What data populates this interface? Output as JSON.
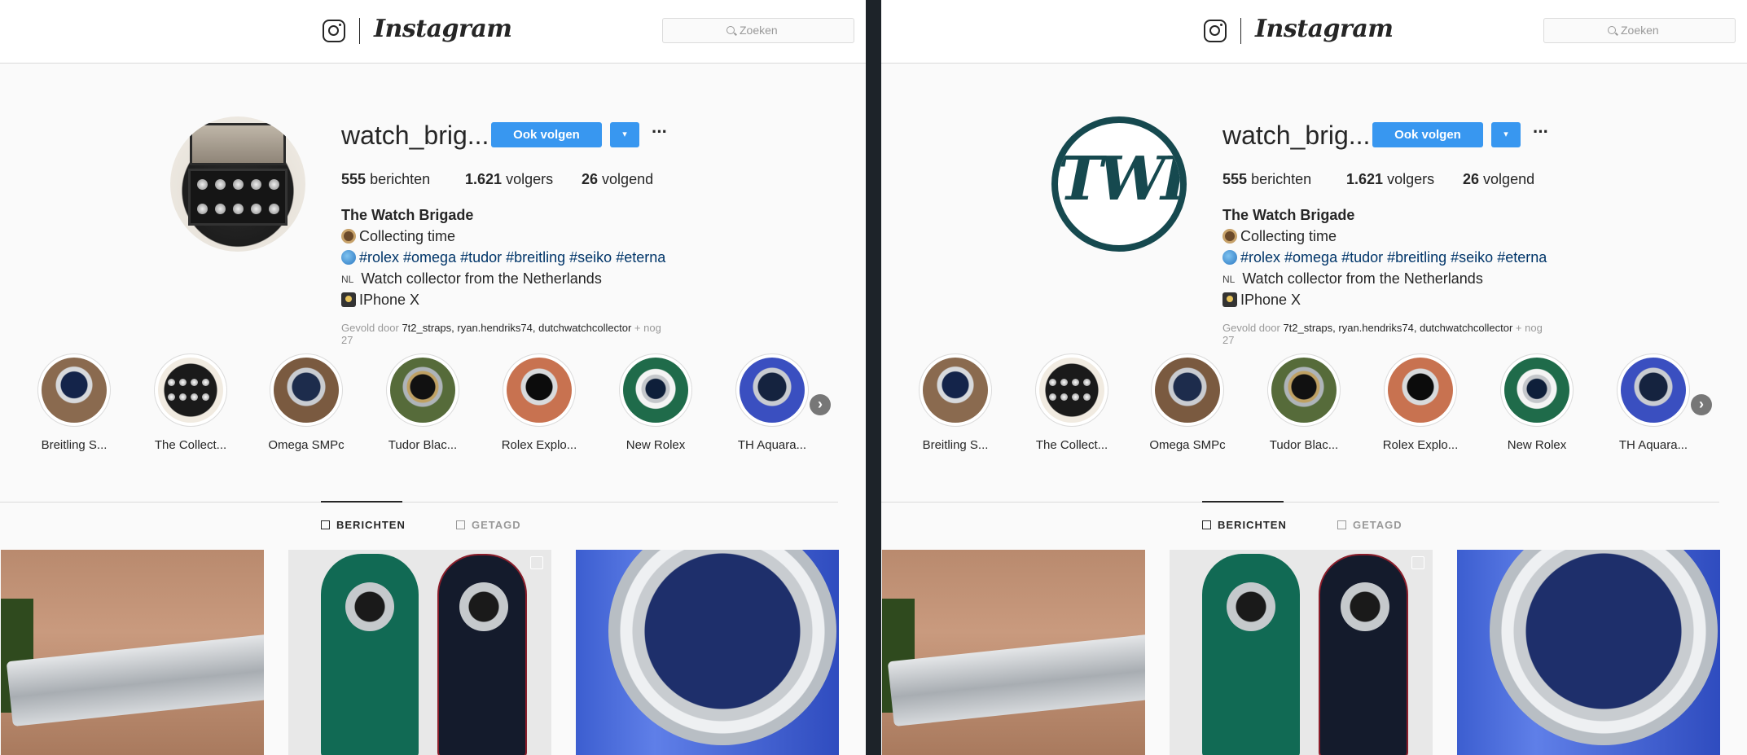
{
  "header": {
    "wordmark": "Instagram",
    "search_placeholder": "Zoeken"
  },
  "profile": {
    "username": "watch_brig...",
    "follow_label": "Ook volgen",
    "dropdown_label": "▾",
    "more_label": "···",
    "stats": {
      "posts_count": "555",
      "posts_label": "berichten",
      "followers_count": "1.621",
      "followers_label": "volgers",
      "following_count": "26",
      "following_label": "volgend"
    },
    "bio": {
      "name": "The Watch Brigade",
      "line1": "Collecting time",
      "line2": "#rolex #omega #tudor #breitling #seiko #eterna",
      "flag": "NL",
      "line3": "Watch collector from the Netherlands",
      "line4": "IPhone X"
    },
    "followed_by_prefix": "Gevold door",
    "followed_by_names": "7t2_straps, ryan.hendriks74, dutchwatchcollector",
    "followed_by_suffix": "+ nog 27"
  },
  "highlights": [
    {
      "label": "Breitling S..."
    },
    {
      "label": "The Collect..."
    },
    {
      "label": "Omega SMPc"
    },
    {
      "label": "Tudor Blac..."
    },
    {
      "label": "Rolex Explo..."
    },
    {
      "label": "New Rolex"
    },
    {
      "label": "TH Aquara..."
    }
  ],
  "tabs": {
    "posts": "BERICHTEN",
    "tagged": "GETAGD"
  },
  "panels": {
    "left_avatar": "watch-box-photo",
    "right_avatar_logo": "TWB"
  },
  "colors": {
    "accent": "#3897f0",
    "logo_teal": "#16494f"
  }
}
